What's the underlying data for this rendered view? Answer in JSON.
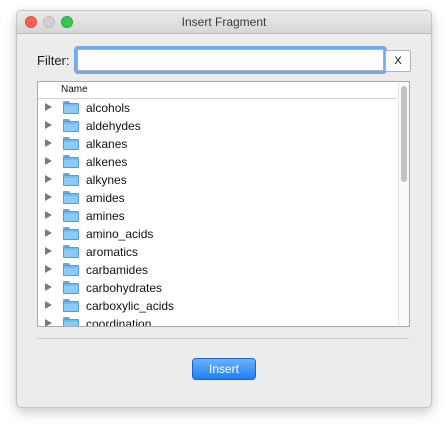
{
  "window": {
    "title": "Insert Fragment"
  },
  "filter": {
    "label": "Filter:",
    "value": "",
    "clear_label": "X"
  },
  "tree": {
    "column_header": "Name",
    "items": [
      {
        "label": "alcohols",
        "icon": "folder-icon"
      },
      {
        "label": "aldehydes",
        "icon": "folder-icon"
      },
      {
        "label": "alkanes",
        "icon": "folder-icon"
      },
      {
        "label": "alkenes",
        "icon": "folder-icon"
      },
      {
        "label": "alkynes",
        "icon": "folder-icon"
      },
      {
        "label": "amides",
        "icon": "folder-icon"
      },
      {
        "label": "amines",
        "icon": "folder-icon"
      },
      {
        "label": "amino_acids",
        "icon": "folder-icon"
      },
      {
        "label": "aromatics",
        "icon": "folder-icon"
      },
      {
        "label": "carbamides",
        "icon": "folder-icon"
      },
      {
        "label": "carbohydrates",
        "icon": "folder-icon"
      },
      {
        "label": "carboxylic_acids",
        "icon": "folder-icon"
      },
      {
        "label": "coordination",
        "icon": "folder-icon"
      }
    ]
  },
  "footer": {
    "insert_label": "Insert"
  },
  "colors": {
    "accent": "#1c7ef7",
    "focus_ring": "#73a9f0",
    "folder": "#6fbdf2"
  }
}
